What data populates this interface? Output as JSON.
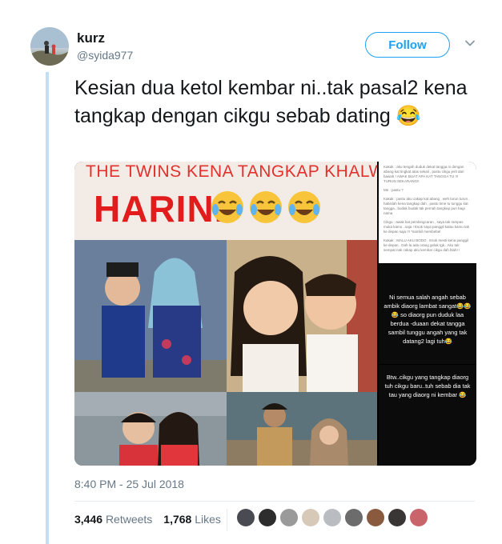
{
  "user": {
    "name": "kurz",
    "handle": "@syida977",
    "follow_label": "Follow"
  },
  "tweet": {
    "text": "Kesian dua ketol kembar ni..tak pasal2 kena tangkap dengan cikgu sebab dating 😂",
    "timestamp": "8:40 PM - 25 Jul 2018"
  },
  "media": {
    "banner_title": "THE TWINS KENA TANGKAP KHALWAT",
    "banner_word": "HARINI",
    "chat_lines": [
      "Kakak : aku tengah duduk dekat tangga ni dengan abang kat tingkat atas sekali , pastu cikgu jerit dari bawah ! AWAK BUAT APA KAT TANGGA TU !!! TURUN SEKARANG!!",
      "Me : pastu ?",
      "Kakak : pastu aku cakap kat abang , weh turun turun , habislah kena tangkap dah , pastu time tu tunggu kat tangga , budak budak tak pernah tangkap pun bagi nama",
      "Cikgu : awak kat pembingcaran , saya tak rampas muka kamu ..saja ! Esok saya panggil kalau kamu tak ke depan saja !!! *sambil membebel",
      "Kakak : MALU AKU BODO . Esok mesti kena panggil ke depan . Dah la ada orang gelak tgk.. Aku tak sempat nak cakap aku kembar cikgu dah blah! !"
    ],
    "caption_1": "Ni semua salah angah sebab ambik diaorg lambat sangat😂😂😂 so diaorg pun duduk laa berdua -duaan dekat tangga sambil tunggu angah yang tak datang2 lagi tuh😂",
    "caption_2": "Btw..cikgu yang tangkap diaorg tuh cikgu baru..tuh sebab dia tak tau yang diaorg ni kembar 😂"
  },
  "stats": {
    "retweets_count": "3,446",
    "retweets_label": "Retweets",
    "likes_count": "1,768",
    "likes_label": "Likes"
  },
  "colors": {
    "accent": "#1da1f2",
    "thread": "#bfe0f5",
    "muted": "#657786",
    "banner_red": "#e21c1c"
  }
}
